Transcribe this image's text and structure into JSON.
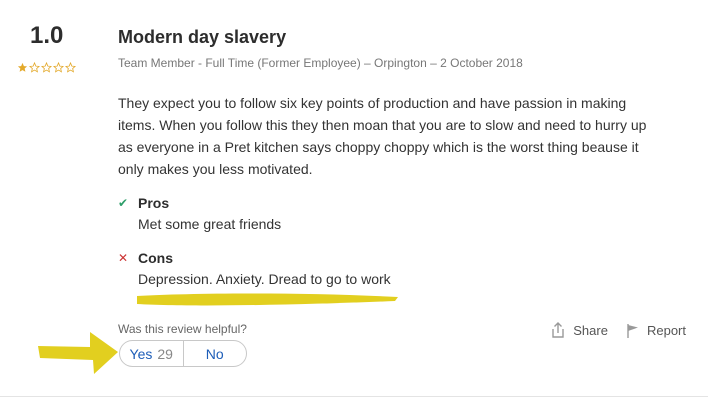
{
  "review": {
    "rating": "1.0",
    "stars": {
      "filled": 1,
      "total": 5
    },
    "title": "Modern day slavery",
    "meta": "Team Member - Full Time (Former Employee) –  Orpington – 2 October 2018",
    "body": "They expect you to follow six key points of production and have passion in making items. When you follow this they then moan that you are to slow and need to hurry up as everyone in a Pret kitchen says choppy choppy which is the worst thing beause it only makes you less motivated.",
    "pros": {
      "mark": "✔",
      "title": "Pros",
      "text": "Met some great friends"
    },
    "cons": {
      "mark": "✕",
      "title": "Cons",
      "text": "Depression. Anxiety. Dread to go to work"
    }
  },
  "helpful": {
    "question": "Was this review helpful?",
    "yes_label": "Yes",
    "yes_count": "29",
    "no_label": "No"
  },
  "actions": {
    "share_label": "Share",
    "share_icon": "share-icon",
    "report_label": "Report",
    "report_icon": "flag-icon"
  },
  "colors": {
    "star_filled": "#e3a92b",
    "star_empty": "#e3a92b",
    "annotation_yellow": "#e2cf1f",
    "link_blue": "#1d5db8",
    "pros_green": "#2e9e6a",
    "cons_red": "#cc3333"
  }
}
